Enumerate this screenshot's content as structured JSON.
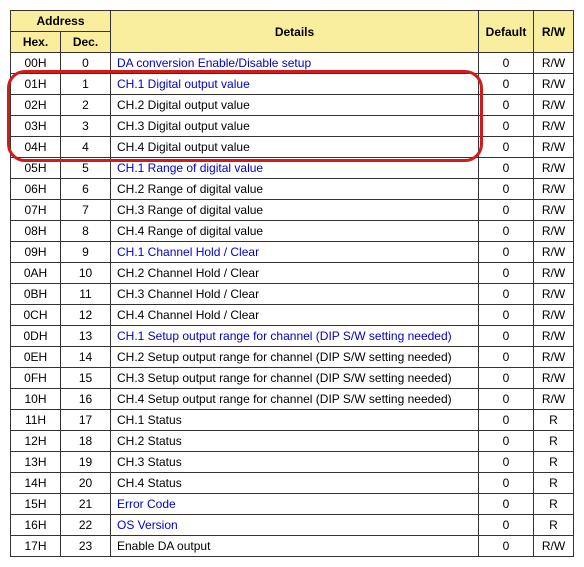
{
  "headers": {
    "address": "Address",
    "hex": "Hex.",
    "dec": "Dec.",
    "details": "Details",
    "default": "Default",
    "rw": "R/W"
  },
  "rows": [
    {
      "hex": "00H",
      "dec": "0",
      "details": "DA conversion Enable/Disable setup",
      "link": true,
      "default": "0",
      "rw": "R/W"
    },
    {
      "hex": "01H",
      "dec": "1",
      "details": "CH.1 Digital output value",
      "link": true,
      "default": "0",
      "rw": "R/W"
    },
    {
      "hex": "02H",
      "dec": "2",
      "details": "CH.2 Digital output value",
      "link": false,
      "default": "0",
      "rw": "R/W"
    },
    {
      "hex": "03H",
      "dec": "3",
      "details": "CH.3 Digital output value",
      "link": false,
      "default": "0",
      "rw": "R/W"
    },
    {
      "hex": "04H",
      "dec": "4",
      "details": "CH.4 Digital output value",
      "link": false,
      "default": "0",
      "rw": "R/W"
    },
    {
      "hex": "05H",
      "dec": "5",
      "details": "CH.1 Range of digital value",
      "link": true,
      "default": "0",
      "rw": "R/W"
    },
    {
      "hex": "06H",
      "dec": "6",
      "details": "CH.2 Range of digital value",
      "link": false,
      "default": "0",
      "rw": "R/W"
    },
    {
      "hex": "07H",
      "dec": "7",
      "details": "CH.3 Range of digital value",
      "link": false,
      "default": "0",
      "rw": "R/W"
    },
    {
      "hex": "08H",
      "dec": "8",
      "details": "CH.4 Range of digital value",
      "link": false,
      "default": "0",
      "rw": "R/W"
    },
    {
      "hex": "09H",
      "dec": "9",
      "details": "CH.1 Channel Hold / Clear",
      "link": true,
      "default": "0",
      "rw": "R/W"
    },
    {
      "hex": "0AH",
      "dec": "10",
      "details": "CH.2 Channel Hold / Clear",
      "link": false,
      "default": "0",
      "rw": "R/W"
    },
    {
      "hex": "0BH",
      "dec": "11",
      "details": "CH.3 Channel Hold / Clear",
      "link": false,
      "default": "0",
      "rw": "R/W"
    },
    {
      "hex": "0CH",
      "dec": "12",
      "details": "CH.4 Channel Hold / Clear",
      "link": false,
      "default": "0",
      "rw": "R/W"
    },
    {
      "hex": "0DH",
      "dec": "13",
      "details": "CH.1 Setup output range for channel (DIP S/W setting needed)",
      "link": true,
      "default": "0",
      "rw": "R/W"
    },
    {
      "hex": "0EH",
      "dec": "14",
      "details": "CH.2 Setup output range for channel (DIP S/W setting needed)",
      "link": false,
      "default": "0",
      "rw": "R/W"
    },
    {
      "hex": "0FH",
      "dec": "15",
      "details": "CH.3 Setup output range for channel (DIP S/W setting needed)",
      "link": false,
      "default": "0",
      "rw": "R/W"
    },
    {
      "hex": "10H",
      "dec": "16",
      "details": "CH.4 Setup output range for channel (DIP S/W setting needed)",
      "link": false,
      "default": "0",
      "rw": "R/W"
    },
    {
      "hex": "11H",
      "dec": "17",
      "details": "CH.1 Status",
      "link": false,
      "default": "0",
      "rw": "R"
    },
    {
      "hex": "12H",
      "dec": "18",
      "details": "CH.2 Status",
      "link": false,
      "default": "0",
      "rw": "R"
    },
    {
      "hex": "13H",
      "dec": "19",
      "details": "CH.3 Status",
      "link": false,
      "default": "0",
      "rw": "R"
    },
    {
      "hex": "14H",
      "dec": "20",
      "details": "CH.4 Status",
      "link": false,
      "default": "0",
      "rw": "R"
    },
    {
      "hex": "15H",
      "dec": "21",
      "details": "Error Code",
      "link": true,
      "default": "0",
      "rw": "R"
    },
    {
      "hex": "16H",
      "dec": "22",
      "details": "OS Version",
      "link": true,
      "default": "0",
      "rw": "R"
    },
    {
      "hex": "17H",
      "dec": "23",
      "details": "Enable DA output",
      "link": false,
      "default": "0",
      "rw": "R/W"
    }
  ],
  "highlight": {
    "from_row": 1,
    "to_row": 4
  }
}
